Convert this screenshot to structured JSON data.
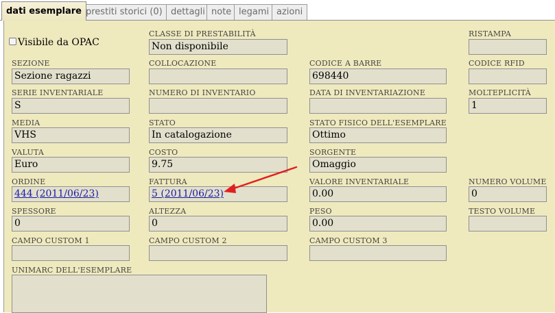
{
  "tabs": [
    {
      "label": "dati esemplare"
    },
    {
      "label": "prestiti storici (0)"
    },
    {
      "label": "dettagli"
    },
    {
      "label": "note"
    },
    {
      "label": "legami"
    },
    {
      "label": "azioni"
    }
  ],
  "form": {
    "visibile_opac": {
      "label": "Visibile da OPAC",
      "checked": false
    },
    "classe_prestabilita": {
      "label": "CLASSE DI PRESTABILITÀ",
      "value": "Non disponibile"
    },
    "ristampa": {
      "label": "RISTAMPA",
      "value": ""
    },
    "sezione": {
      "label": "SEZIONE",
      "value": "Sezione ragazzi"
    },
    "collocazione": {
      "label": "COLLOCAZIONE",
      "value": ""
    },
    "codice_barre": {
      "label": "CODICE A BARRE",
      "value": "698440"
    },
    "codice_rfid": {
      "label": "CODICE RFID",
      "value": ""
    },
    "serie_inventariale": {
      "label": "SERIE INVENTARIALE",
      "value": "S"
    },
    "numero_inventario": {
      "label": "NUMERO DI INVENTARIO",
      "value": ""
    },
    "data_inventariazione": {
      "label": "DATA DI INVENTARIAZIONE",
      "value": ""
    },
    "molteplicita": {
      "label": "MOLTEPLICITÀ",
      "value": "1"
    },
    "media": {
      "label": "MEDIA",
      "value": "VHS"
    },
    "stato": {
      "label": "STATO",
      "value": "In catalogazione"
    },
    "stato_fisico": {
      "label": "STATO FISICO DELL'ESEMPLARE",
      "value": "Ottimo"
    },
    "valuta": {
      "label": "VALUTA",
      "value": "Euro"
    },
    "costo": {
      "label": "COSTO",
      "value": "9.75"
    },
    "sorgente": {
      "label": "SORGENTE",
      "value": "Omaggio"
    },
    "ordine": {
      "label": "ORDINE",
      "value": "444 (2011/06/23)"
    },
    "fattura": {
      "label": "FATTURA",
      "value": "5 (2011/06/23)"
    },
    "valore_inventariale": {
      "label": "VALORE INVENTARIALE",
      "value": "0.00"
    },
    "numero_volume": {
      "label": "NUMERO VOLUME",
      "value": "0"
    },
    "spessore": {
      "label": "SPESSORE",
      "value": "0"
    },
    "altezza": {
      "label": "ALTEZZA",
      "value": "0"
    },
    "peso": {
      "label": "PESO",
      "value": "0.00"
    },
    "testo_volume": {
      "label": "TESTO VOLUME",
      "value": ""
    },
    "campo_custom_1": {
      "label": "CAMPO CUSTOM 1",
      "value": ""
    },
    "campo_custom_2": {
      "label": "CAMPO CUSTOM 2",
      "value": ""
    },
    "campo_custom_3": {
      "label": "CAMPO CUSTOM 3",
      "value": ""
    },
    "unimarc": {
      "label": "UNIMARC DELL'ESEMPLARE",
      "value": ""
    }
  },
  "colors": {
    "panel_bg": "#efe9be",
    "field_bg": "#e2e0cc",
    "link": "#1a1aa8",
    "annotation_arrow": "#e02020"
  }
}
